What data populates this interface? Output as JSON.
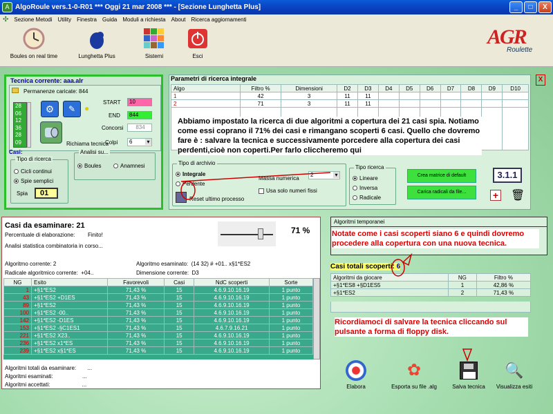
{
  "window": {
    "title": "AlgoRoule vers.1-0-R01  ***  Oggi 21 mar 2008  ***  - [Sezione Lunghetta Plus]",
    "min": "_",
    "max": "□",
    "close": "X"
  },
  "menu": [
    "Sezione Metodi",
    "Utility",
    "Finestra",
    "Guida",
    "Moduli a richiesta",
    "About",
    "Ricerca aggiornamenti"
  ],
  "toolbar": {
    "boules": "Boules on real time",
    "lunghetta": "Lunghetta Plus",
    "sistemi": "Sistemi",
    "esci": "Esci",
    "logo": "AGR",
    "logo_sub": "Roulette"
  },
  "tecnica": {
    "title": "Tecnica corrente: aaa.alr",
    "permanenze": "Permanenze caricate: 844",
    "start_label": "START",
    "start": "10",
    "end_label": "END",
    "end": "844",
    "concorsi_label": "Concorsi",
    "concorsi": "834",
    "colpi_label": "Colpi",
    "colpi": "6",
    "richiama": "Richiama tecnica",
    "list": [
      "28",
      "06",
      "12",
      "36",
      "28",
      "09"
    ],
    "casi_label": "Casi:",
    "tipo_title": "Tipo di ricerca",
    "cicli": "Cicli continui",
    "spie": "Spie semplici",
    "spia_label": "Spia",
    "spia": "01",
    "analisi_title": "Analisi su...",
    "boules_opt": "Boules",
    "anamnesi_opt": "Anamnesi"
  },
  "params": {
    "title": "Parametri di ricerca integrale",
    "headers": [
      "Algo",
      "Filtro %",
      "Dimensioni",
      "D2",
      "D3",
      "D4",
      "D5",
      "D6",
      "D7",
      "D8",
      "D9",
      "D10"
    ],
    "rows": [
      [
        "1",
        "42",
        "3",
        "11",
        "11",
        "",
        "",
        "",
        "",
        "",
        "",
        ""
      ],
      [
        "2",
        "71",
        "3",
        "11",
        "11",
        "",
        "",
        "",
        "",
        "",
        "",
        ""
      ]
    ],
    "close": "X"
  },
  "note_main": "Abbiamo impostato la ricerca di due algoritmi a copertura dei 21 casi spia. Notiamo come essi coprano il 71% dei casi e rimangano scoperti 6 casi. Quello che dovremo fare è : salvare la tecnica e successivamente porcedere alla copertura dei casi perdenti,cioè non coperti.Per farlo cliccheremo qui",
  "archivio": {
    "title": "Tipo di archivio",
    "integrale": "Integrale",
    "perdente": "Perdente",
    "massa_label": "Massa numerica",
    "massa": "2",
    "solo_label": "Usa solo numeri fissi",
    "reset": "Reset ultimo processo"
  },
  "ricerca": {
    "title": "Tipo ricerca",
    "lineare": "Lineare",
    "inversa": "Inversa",
    "radicale": "Radicale"
  },
  "buttons": {
    "crea": "Crea matrice di default",
    "carica": "Carica radicali da file...",
    "version": "3.1.1",
    "plus": "+"
  },
  "casi": {
    "title": "Casi da esaminare: 21",
    "perc_label": "Percentuale di elaborazione:",
    "perc_value": "Finito!",
    "perc": "71 %",
    "analisi": "Analisi statistica combinatoria in corso...",
    "algo_corr_label": "Algoritmo corrente:",
    "algo_corr": "2",
    "algo_esam_label": "Algoritmo esaminato:",
    "algo_esam": "(14 32) # +01.. x§1*ES2",
    "radicale_label": "Radicale algoritmico corrente:",
    "radicale": "+04..",
    "dim_label": "Dimensione corrente:",
    "dim": "D3",
    "headers": [
      "NG",
      "Esito",
      "Favorevoli",
      "Casi",
      "NdC scoperti",
      "Sorte"
    ],
    "rows": [
      [
        "1",
        "+§1*ES2",
        "71,43 %",
        "15",
        "4.6.9.10.16.19",
        "1 punto"
      ],
      [
        "43",
        "+§1*ES2 +D1ES",
        "71,43 %",
        "15",
        "4.6.9.10.16.19",
        "1 punto"
      ],
      [
        "89",
        "+§1*ES2",
        "71,43 %",
        "15",
        "4.6.9.10.16.19",
        "1 punto"
      ],
      [
        "100",
        "+§1*ES2 -00..",
        "71,43 %",
        "15",
        "4.6.9.10.16.19",
        "1 punto"
      ],
      [
        "142",
        "+§1*ES2 -D1ES",
        "71,43 %",
        "15",
        "4.6.9.10.16.19",
        "1 punto"
      ],
      [
        "153",
        "+§1*ES2 -§C1ES1",
        "71,43 %",
        "15",
        "4.6.7.9.16.21",
        "1 punto"
      ],
      [
        "221",
        "+§1*ES2 X23..",
        "71,43 %",
        "15",
        "4.6.9.10.16.19",
        "1 punto"
      ],
      [
        "236",
        "+§1*ES2 x1*ES",
        "71,43 %",
        "15",
        "4.6.9.10.16.19",
        "1 punto"
      ],
      [
        "239",
        "+§1*ES2 x§1*ES",
        "71,43 %",
        "15",
        "4.6.9.10.16.19",
        "1 punto"
      ]
    ],
    "tot_label": "Algoritmi totali da esaminare:",
    "tot": "...",
    "esam_label": "Algoritmi esaminati:",
    "esam": "...",
    "acc_label": "Algoritmi accettati:",
    "acc": "..."
  },
  "temp": {
    "title": "Algoritmi temporanei"
  },
  "note_right1": "Notate come i casi scoperti siano 6 e quindi dovremo procedere alla copertura con una nuova tecnica.",
  "scoperti": {
    "label": "Casi totali scoperti:",
    "value": "6"
  },
  "giocare": {
    "headers": [
      "Algoritmi da giocare",
      "NG",
      "Filtro %"
    ],
    "rows": [
      [
        "+§1*ES8 +§D1ES5",
        "1",
        "42,86 %"
      ],
      [
        "+§1*ES2",
        "2",
        "71,43 %"
      ]
    ]
  },
  "note_right2": "Ricordiamoci di salvare la tecnica cliccando sul pulsante a forma di floppy disk.",
  "bottom": {
    "elabora": "Elabora",
    "esporta": "Esporta su file .alg",
    "salva": "Salva tecnica",
    "visualizza": "Visualizza esiti"
  }
}
